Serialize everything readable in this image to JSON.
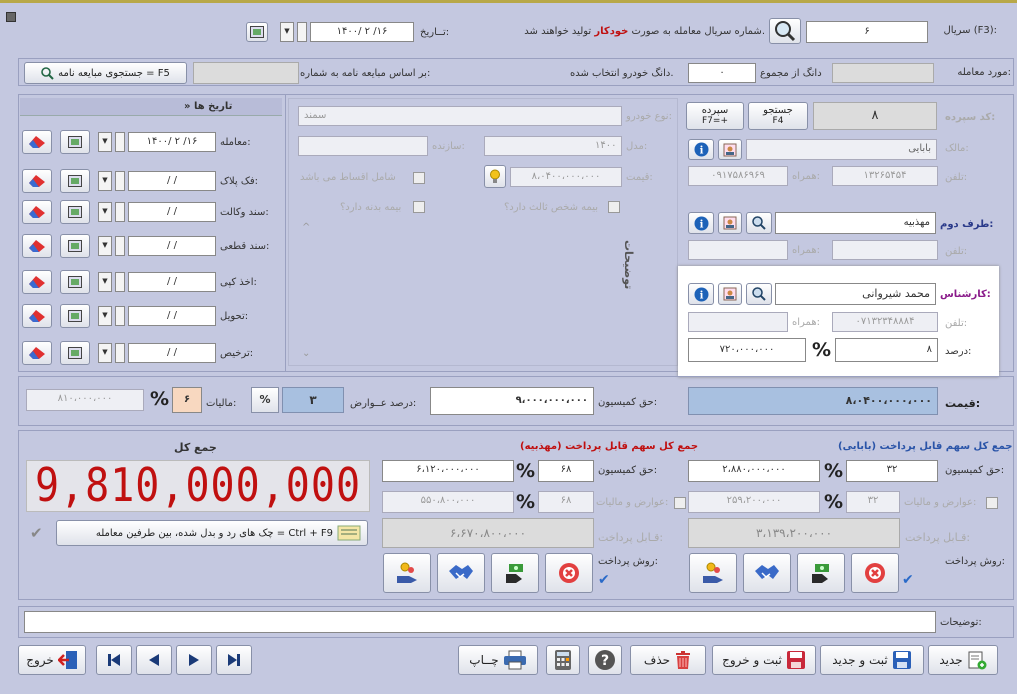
{
  "header": {
    "serial_label": "سریال (F3):",
    "serial_value": "۶",
    "serial_note_prefix": "شماره سریال معامله به صورت",
    "serial_note_auto": "خودکار",
    "serial_note_suffix": "تولید خواهند شد.",
    "date_label": "تــاریخ:",
    "date_value": "۱۴۰۰/ ۲ /۱۶"
  },
  "row2": {
    "subject_label": "مورد معامله:",
    "dang_from_total": "دانگ از مجموع",
    "dang_value": "۰",
    "dang_selected": "دانگ خودرو انتخاب شده.",
    "by_contract_label": "بر اساس مبایعه نامه به شماره:",
    "search_contract_btn": "جستجوی مبایعه نامه = F5"
  },
  "seller": {
    "code_label": "کد سپرده:",
    "code_value": "۸",
    "search_btn": "جستجو",
    "search_key": "F4",
    "deposit_btn": "سپرده",
    "deposit_key": "F7=+",
    "owner_label": "مالک:",
    "owner_value": "بابایی",
    "phone_label": "تلفن:",
    "phone_value": "۱۳۲۶۵۴۵۴",
    "mobile_label": "همراه:",
    "mobile_value": "۰۹۱۷۵۸۶۹۶۹"
  },
  "car": {
    "type_label": "نوع خودرو:",
    "type_value": "سمند",
    "model_label": "مدل:",
    "model_value": "۱۴۰۰",
    "maker_label": "سازنده:",
    "maker_value": "",
    "price_label": "قیمت:",
    "price_value": "۸،۰۴۰۰،۰۰۰،۰۰۰",
    "installment_label": "شامل اقساط می باشد",
    "third_party_label": "بیمه شخص ثالث دارد؟",
    "body_ins_label": "بیمه بدنه دارد؟",
    "notes_vertical": "توضیحات"
  },
  "dates": {
    "title": "» تاریخ ها",
    "rows": [
      {
        "label": "معامله:",
        "value": "۱۴۰۰/ ۲ /۱۶"
      },
      {
        "label": "فک پلاک:",
        "value": "/   /"
      },
      {
        "label": "سند وکالت:",
        "value": "/   /"
      },
      {
        "label": "سند قطعی:",
        "value": "/   /"
      },
      {
        "label": "اخذ کپی:",
        "value": "/   /"
      },
      {
        "label": "تحویل:",
        "value": "/   /"
      },
      {
        "label": "ترخیص:",
        "value": "/   /"
      }
    ]
  },
  "buyer": {
    "label": "طرف دوم:",
    "value": "مهذبیه",
    "phone_label": "تلفن:",
    "mobile_label": "همراه:"
  },
  "agent": {
    "label": "کارشناس:",
    "value": "محمد شیروانی",
    "phone_label": "تلفن:",
    "mobile_label": "همراه:",
    "mobile_value": "۰۷۱۳۲۳۴۸۸۸۴",
    "percent_label": "درصد:",
    "percent_value": "۸",
    "amount_value": "۷۲۰،۰۰۰،۰۰۰"
  },
  "fees": {
    "price_label": "قیمت:",
    "price_value": "۸،۰۴۰۰،۰۰۰،۰۰۰",
    "commission_label": "حق کمیسیون:",
    "commission_value": "۹،۰۰۰،۰۰۰،۰۰۰",
    "duty_label": "درصد عــوارض:",
    "duty_value": "۳",
    "tax_label": "مالیات:",
    "tax_value": "۶",
    "tax_amount": "۸۱۰،۰۰۰،۰۰۰"
  },
  "seller_sum": {
    "title": "جمع کل سهم قابل پرداخت (بابایی)",
    "commission_label": "حق کمیسیون:",
    "commission_amount": "۲،۸۸۰،۰۰۰،۰۰۰",
    "commission_pct": "۳۲",
    "tax_label": "عوارض و مالیات:",
    "tax_amount": "۲۵۹،۲۰۰،۰۰۰",
    "tax_pct": "۳۲",
    "payable_label": "قـابل پرداخت:",
    "payable_value": "۳،۱۳۹،۲۰۰،۰۰۰",
    "method_label": "روش پرداخت:"
  },
  "buyer_sum": {
    "title": "جمع کل سهم قابل پرداخت (مهذبیه)",
    "commission_label": "حق کمیسیون:",
    "commission_amount": "۶،۱۲۰،۰۰۰،۰۰۰",
    "commission_pct": "۶۸",
    "tax_label": "عوارض و مالیات:",
    "tax_amount": "۵۵۰،۸۰۰،۰۰۰",
    "tax_pct": "۶۸",
    "payable_label": "قـابل پرداخت:",
    "payable_value": "۶،۶۷۰،۸۰۰،۰۰۰",
    "method_label": "روش پرداخت:"
  },
  "total": {
    "title": "جمع کل",
    "value": "9,810,000,000",
    "checks_btn": "چک های رد و بدل شده، بین طرفین معامله = Ctrl + F9"
  },
  "notes_label": "توضیحات:",
  "toolbar": {
    "new": "جدید",
    "save_new": "ثبت و جدید",
    "save_exit": "ثبت و خروج",
    "delete": "حذف",
    "print": "چــاپ",
    "exit": "خروج"
  },
  "colors": {
    "background": "#c4c8e0",
    "total_red": "#c01010",
    "title_blue": "#2a54a8",
    "agent_purple": "#8a1a8a"
  }
}
